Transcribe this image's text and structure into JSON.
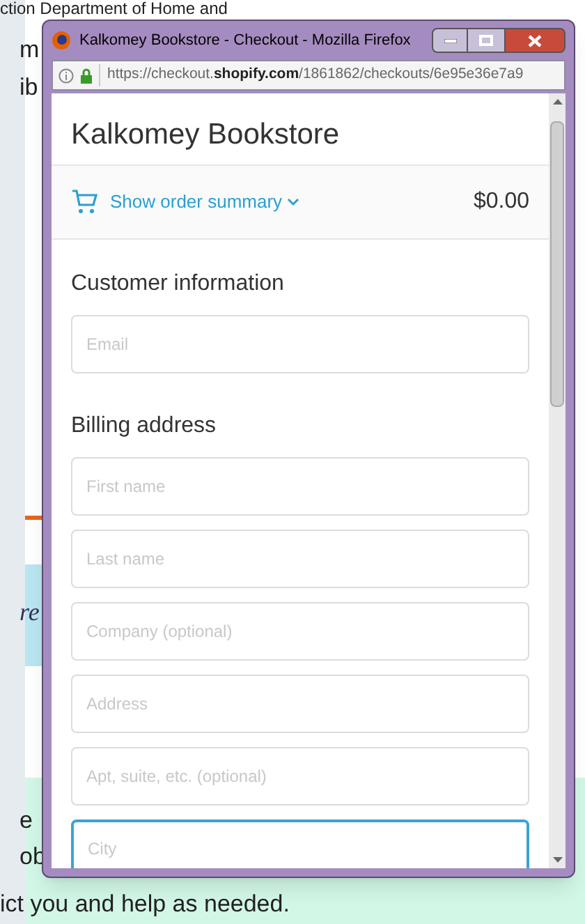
{
  "background_page": {
    "lines": [
      {
        "text": "ction Department of Home and",
        "kind": "plain"
      },
      {
        "text": "m",
        "kind": "plain"
      },
      {
        "text": "ib",
        "kind": "plain"
      },
      {
        "text": "re",
        "kind": "italic"
      },
      {
        "text": "e",
        "kind": "plain"
      },
      {
        "text": "ob",
        "kind": "plain"
      },
      {
        "text": "ict you and help as needed.",
        "kind": "plain"
      }
    ]
  },
  "window": {
    "title": "Kalkomey Bookstore - Checkout - Mozilla Firefox",
    "url": "https://checkout.**shopify.com**/1861862/checkouts/6e95e36e7a9"
  },
  "store_name": "Kalkomey Bookstore",
  "order_summary": {
    "toggle": "Show order summary",
    "total": "$0.00"
  },
  "sections": [
    {
      "heading": "Customer information",
      "fields": [
        {
          "placeholder": "Email",
          "focused": false
        }
      ]
    },
    {
      "heading": "Billing address",
      "fields": [
        {
          "placeholder": "First name",
          "focused": false
        },
        {
          "placeholder": "Last name",
          "focused": false
        },
        {
          "placeholder": "Company (optional)",
          "focused": false
        },
        {
          "placeholder": "Address",
          "focused": false
        },
        {
          "placeholder": "Apt, suite, etc. (optional)",
          "focused": false
        },
        {
          "placeholder": "City",
          "focused": true
        }
      ]
    }
  ]
}
